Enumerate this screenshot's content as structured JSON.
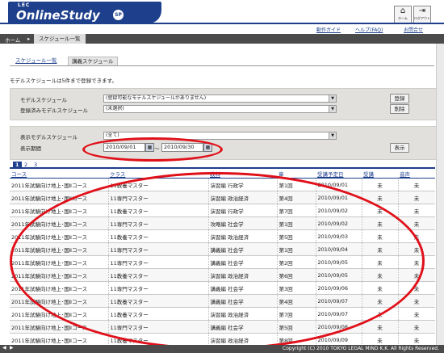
{
  "header": {
    "logo_small": "LEC",
    "logo_title": "OnlineStudy",
    "logo_badge": "SP",
    "home_label": "ホーム",
    "logout_label": "ログアウト",
    "links": [
      "動作ガイド",
      "ヘルプ(FAQ)",
      "お問合せ"
    ]
  },
  "breadcrumb": {
    "home": "ホーム",
    "current": "スケジュール一覧"
  },
  "tabs": [
    "スケジュール一覧",
    "講義スケジュール"
  ],
  "note": "モデルスケジュールは5件まで登録できます。",
  "model_panel": {
    "model_label": "モデルスケジュール",
    "model_value": "(登録可能なモデルスケジュールがありません)",
    "registered_label": "登録済みモデルスケジュール",
    "registered_value": "(未選択)",
    "register_button": "登録",
    "delete_button": "削除"
  },
  "filter_panel": {
    "display_label": "表示モデルスケジュール",
    "display_value": "(全て)",
    "period_label": "表示期間",
    "date_from": "2010/09/01",
    "date_sep": "～",
    "date_to": "2010/09/30",
    "show_button": "表示"
  },
  "pager": [
    "1",
    "2",
    "3"
  ],
  "table": {
    "headers": [
      "コース",
      "クラス",
      "教科",
      "章",
      "受講予定日",
      "受講",
      "音声"
    ],
    "rows": [
      [
        "2011年試験向け地上･国Ⅱコース",
        "11教養マスター",
        "演習編 行政学",
        "第1回",
        "2010/09/01",
        "未",
        "未"
      ],
      [
        "2011年試験向け地上･国Ⅱコース",
        "11専門マスター",
        "演習編 政治経済",
        "第4回",
        "2010/09/01",
        "未",
        "未"
      ],
      [
        "2011年試験向け地上･国Ⅱコース",
        "11教養マスター",
        "演習編 行政学",
        "第7回",
        "2010/09/02",
        "未",
        "未"
      ],
      [
        "2011年試験向け地上･国Ⅱコース",
        "11専門マスター",
        "攻略編 社会学",
        "第1回",
        "2010/09/02",
        "未",
        "未"
      ],
      [
        "2011年試験向け地上･国Ⅱコース",
        "11教養マスター",
        "演習編 政治経済",
        "第5回",
        "2010/09/03",
        "未",
        "未"
      ],
      [
        "2011年試験向け地上･国Ⅱコース",
        "11専門マスター",
        "講義編 社会学",
        "第1回",
        "2010/09/04",
        "未",
        "未"
      ],
      [
        "2011年試験向け地上･国Ⅱコース",
        "11専門マスター",
        "講義編 社会学",
        "第2回",
        "2010/09/05",
        "未",
        "未"
      ],
      [
        "2011年試験向け地上･国Ⅱコース",
        "11教養マスター",
        "演習編 政治経済",
        "第6回",
        "2010/09/05",
        "未",
        "未"
      ],
      [
        "2011年試験向け地上･国Ⅱコース",
        "11専門マスター",
        "講義編 社会学",
        "第3回",
        "2010/09/06",
        "未",
        "未"
      ],
      [
        "2011年試験向け地上･国Ⅱコース",
        "11教養マスター",
        "講義編 社会学",
        "第4回",
        "2010/09/07",
        "未",
        "未"
      ],
      [
        "2011年試験向け地上･国Ⅱコース",
        "11教養マスター",
        "演習編 政治経済",
        "第7回",
        "2010/09/07",
        "未",
        "未"
      ],
      [
        "2011年試験向け地上･国Ⅱコース",
        "11専門マスター",
        "講義編 社会学",
        "第5回",
        "2010/09/08",
        "未",
        "未"
      ],
      [
        "2011年試験向け地上･国Ⅱコース",
        "11教養マスター",
        "演習編 政治経済",
        "第8回",
        "2010/09/09",
        "未",
        "未"
      ]
    ]
  },
  "footer": {
    "copyright": "Copyright (C) 2010 TOKYO LEGAL MIND K.K. All Rights Reserved."
  },
  "accent_color": "#1e3f8c",
  "highlight_color": "#e0101a"
}
